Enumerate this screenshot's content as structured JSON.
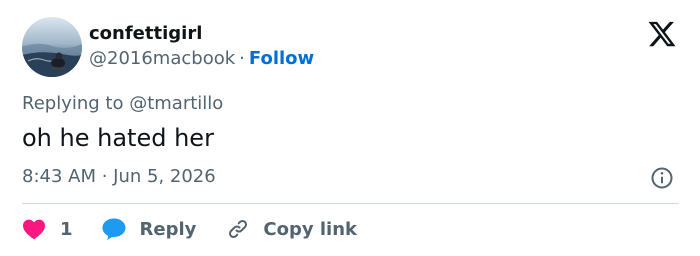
{
  "user": {
    "display_name": "confettigirl",
    "handle": "@2016macbook",
    "separator": "·",
    "follow_label": "Follow"
  },
  "reply_context": "Replying to @tmartillo",
  "tweet": {
    "text": "oh he hated her",
    "timestamp": "8:43 AM · Jun 5, 2026"
  },
  "actions": {
    "like_count": "1",
    "reply_label": "Reply",
    "copy_link_label": "Copy link"
  },
  "icons": {
    "logo": "x-logo-icon",
    "info": "info-icon",
    "like": "heart-icon",
    "reply": "speech-bubble-icon",
    "copy": "link-icon"
  },
  "colors": {
    "follow": "#006fd6",
    "like": "#f91880",
    "reply": "#1d9bf0",
    "secondary_text": "#536471"
  }
}
